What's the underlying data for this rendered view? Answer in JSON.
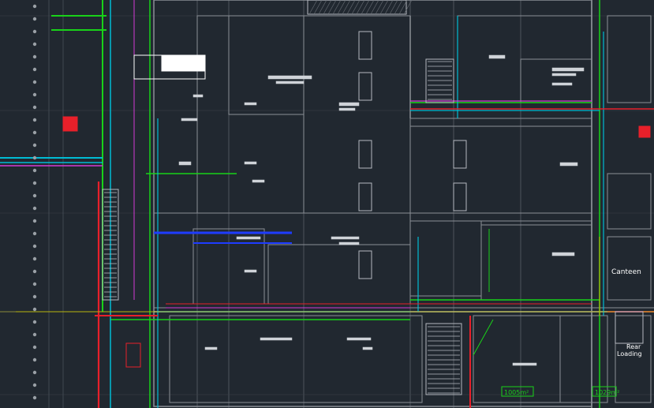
{
  "viewport": {
    "background": "#212830"
  },
  "colors": {
    "wall": "#8a8f96",
    "wall_light": "#b5b9bf",
    "green": "#19d219",
    "cyan": "#00bcd4",
    "red": "#e8202a",
    "magenta": "#d43ad6",
    "blue": "#1f3cff",
    "yellow": "#c8c400",
    "white": "#ffffff",
    "olive": "#8a8a3a"
  },
  "labels": {
    "canteen": "Canteen",
    "rear": "Rear",
    "loading": "Loading",
    "area_1": "1005m²",
    "area_2": "1029m²"
  }
}
